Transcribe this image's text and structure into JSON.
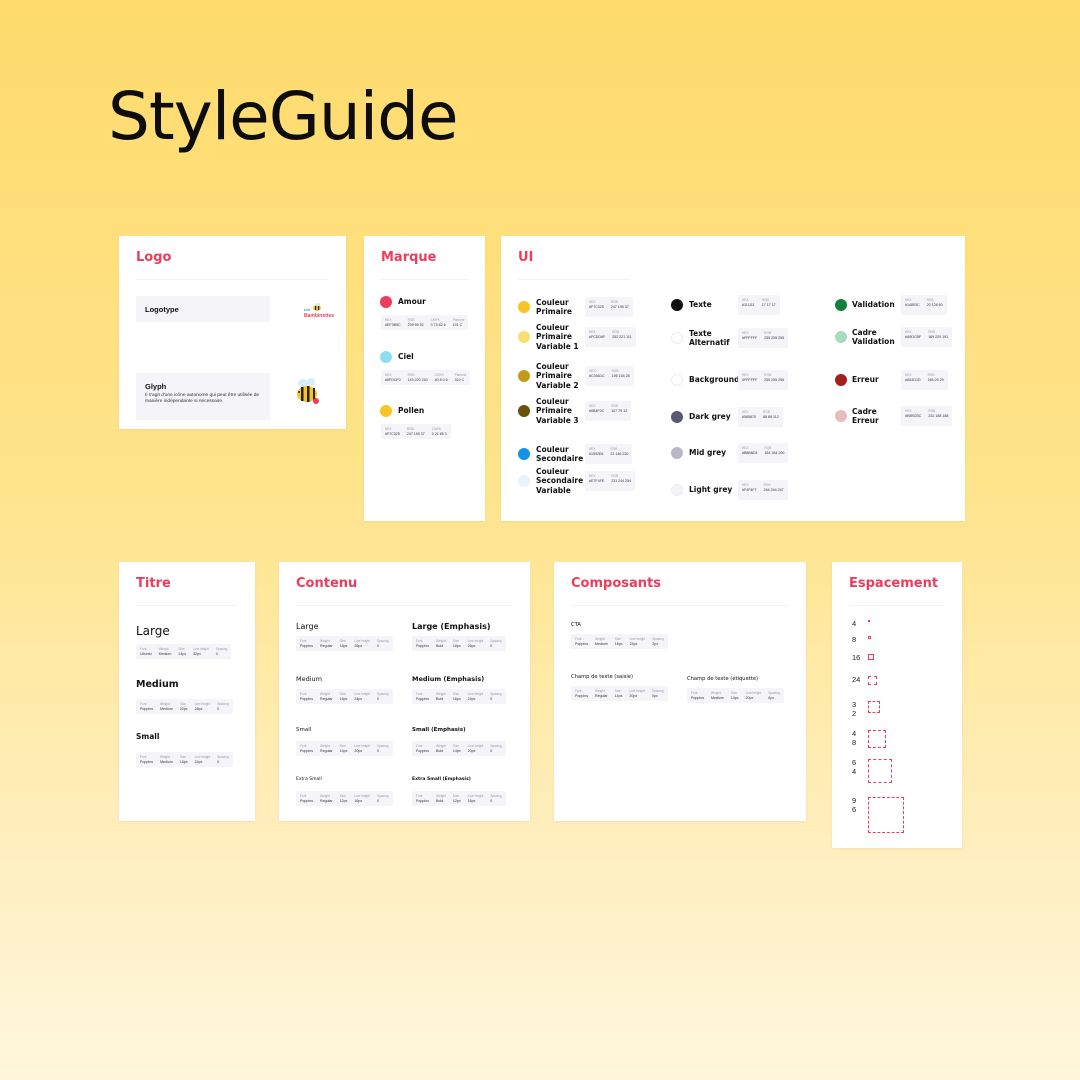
{
  "page": {
    "title": "StyleGuide"
  },
  "colors": {
    "accent": "#ef3b5c"
  },
  "logo_card": {
    "title": "Logo",
    "logotype_label": "Logotype",
    "logotype_icon": "bee-logotype-icon",
    "logotype_text_small": "Les",
    "logotype_text": "Bambinettes",
    "glyph_label": "Glyph",
    "glyph_desc": "Il s'agit d'une icône autonome qui peut être utilisée de manière indépendante si nécessaire.",
    "glyph_icon": "bee-glyph-icon"
  },
  "marque_card": {
    "title": "Marque",
    "items": [
      {
        "name": "Amour",
        "color": "#ef3b5c",
        "specs": [
          [
            "HEX",
            "#EF3B5C"
          ],
          [
            "RGB",
            "239 59 92"
          ],
          [
            "CMYK",
            "0 75 62 6"
          ],
          [
            "Pantone",
            "191 C"
          ]
        ]
      },
      {
        "name": "Ciel",
        "color": "#8fdcf0",
        "specs": [
          [
            "HEX",
            "#8FDCF0"
          ],
          [
            "RGB",
            "143 220 240"
          ],
          [
            "CMYK",
            "40 8 0 6"
          ],
          [
            "Pantone",
            "310 C"
          ]
        ]
      },
      {
        "name": "Pollen",
        "color": "#f7c325",
        "specs": [
          [
            "HEX",
            "#F7C325"
          ],
          [
            "RGB",
            "247 195 37"
          ],
          [
            "CMYK",
            "0 21 85 3"
          ]
        ]
      }
    ]
  },
  "ui_card": {
    "title": "UI",
    "columns": [
      [
        {
          "name": "Couleur Primaire",
          "color": "#f7c325",
          "hex": "#F7C325",
          "rgb": "247 195 37"
        },
        {
          "name": "Couleur Primaire Variable 1",
          "color": "#fcdd6f",
          "hex": "#FCDD6F",
          "rgb": "252 221 111"
        },
        {
          "name": "Couleur Primaire Variable 2",
          "color": "#c39a1c",
          "hex": "#C39A1C",
          "rgb": "195 154 28"
        },
        {
          "name": "Couleur Primaire Variable 3",
          "color": "#6b4f0c",
          "hex": "#6B4F0C",
          "rgb": "107 79 12"
        },
        {
          "name": "Couleur Secondaire",
          "color": "#1592e6",
          "hex": "#1592E6",
          "rgb": "21 146 230"
        },
        {
          "name": "Couleur Secondaire Variable",
          "color": "#e7f4fe",
          "hex": "#E7F4FE",
          "rgb": "231 244 254"
        }
      ],
      [
        {
          "name": "Texte",
          "color": "#111111",
          "hex": "#111111",
          "rgb": "17 17 17"
        },
        {
          "name": "Texte Alternatif",
          "color": "#ffffff",
          "hex": "#FFFFFF",
          "rgb": "255 255 255"
        },
        {
          "name": "Background",
          "color": "#ffffff",
          "hex": "#FFFFFF",
          "rgb": "255 255 255"
        },
        {
          "name": "Dark grey",
          "color": "#585870",
          "hex": "#585870",
          "rgb": "88 88 112"
        },
        {
          "name": "Mid grey",
          "color": "#b8b8c8",
          "hex": "#B8B8C8",
          "rgb": "184 184 200"
        },
        {
          "name": "Light grey",
          "color": "#f4f4f7",
          "hex": "#F4F4F7",
          "rgb": "244 244 247"
        }
      ],
      [
        {
          "name": "Validation",
          "color": "#14803c",
          "hex": "#14803C",
          "rgb": "20 128 60"
        },
        {
          "name": "Cadre Validation",
          "color": "#a9dcbf",
          "hex": "#A9DCBF",
          "rgb": "169 220 191"
        },
        {
          "name": "Erreur",
          "color": "#a51d1d",
          "hex": "#A51D1D",
          "rgb": "165 29 29"
        },
        {
          "name": "Cadre Erreur",
          "color": "#e8bcbc",
          "hex": "#E8BCBC",
          "rgb": "232 188 188"
        }
      ]
    ]
  },
  "titre_card": {
    "title": "Titre",
    "items": [
      {
        "label": "Large",
        "specs": [
          [
            "Font",
            "Ubuntu"
          ],
          [
            "Weight",
            "Medium"
          ],
          [
            "Size",
            "24px"
          ],
          [
            "Line height",
            "32px"
          ],
          [
            "Spacing",
            "0"
          ]
        ]
      },
      {
        "label": "Medium",
        "specs": [
          [
            "Font",
            "Poppins"
          ],
          [
            "Weight",
            "Medium"
          ],
          [
            "Size",
            "20px"
          ],
          [
            "Line height",
            "28px"
          ],
          [
            "Spacing",
            "0"
          ]
        ]
      },
      {
        "label": "Small",
        "specs": [
          [
            "Font",
            "Poppins"
          ],
          [
            "Weight",
            "Medium"
          ],
          [
            "Size",
            "16px"
          ],
          [
            "Line height",
            "24px"
          ],
          [
            "Spacing",
            "0"
          ]
        ]
      }
    ]
  },
  "contenu_card": {
    "title": "Contenu",
    "items": [
      {
        "label": "Large",
        "specs": [
          [
            "Font",
            "Poppins"
          ],
          [
            "Weight",
            "Regular"
          ],
          [
            "Size",
            "18px"
          ],
          [
            "Line height",
            "26px"
          ],
          [
            "Spacing",
            "0"
          ]
        ]
      },
      {
        "label": "Large (Emphasis)",
        "specs": [
          [
            "Font",
            "Poppins"
          ],
          [
            "Weight",
            "Bold"
          ],
          [
            "Size",
            "18px"
          ],
          [
            "Line height",
            "26px"
          ],
          [
            "Spacing",
            "0"
          ]
        ]
      },
      {
        "label": "Medium",
        "specs": [
          [
            "Font",
            "Poppins"
          ],
          [
            "Weight",
            "Regular"
          ],
          [
            "Size",
            "16px"
          ],
          [
            "Line height",
            "24px"
          ],
          [
            "Spacing",
            "0"
          ]
        ]
      },
      {
        "label": "Medium (Emphasis)",
        "specs": [
          [
            "Font",
            "Poppins"
          ],
          [
            "Weight",
            "Bold"
          ],
          [
            "Size",
            "16px"
          ],
          [
            "Line height",
            "24px"
          ],
          [
            "Spacing",
            "0"
          ]
        ]
      },
      {
        "label": "Small",
        "specs": [
          [
            "Font",
            "Poppins"
          ],
          [
            "Weight",
            "Regular"
          ],
          [
            "Size",
            "14px"
          ],
          [
            "Line height",
            "20px"
          ],
          [
            "Spacing",
            "0"
          ]
        ]
      },
      {
        "label": "Small (Emphasis)",
        "specs": [
          [
            "Font",
            "Poppins"
          ],
          [
            "Weight",
            "Bold"
          ],
          [
            "Size",
            "14px"
          ],
          [
            "Line height",
            "20px"
          ],
          [
            "Spacing",
            "0"
          ]
        ]
      },
      {
        "label": "Extra Small",
        "specs": [
          [
            "Font",
            "Poppins"
          ],
          [
            "Weight",
            "Regular"
          ],
          [
            "Size",
            "12px"
          ],
          [
            "Line height",
            "16px"
          ],
          [
            "Spacing",
            "0"
          ]
        ]
      },
      {
        "label": "Extra Small (Emphasis)",
        "specs": [
          [
            "Font",
            "Poppins"
          ],
          [
            "Weight",
            "Bold"
          ],
          [
            "Size",
            "12px"
          ],
          [
            "Line height",
            "16px"
          ],
          [
            "Spacing",
            "0"
          ]
        ]
      }
    ]
  },
  "composants_card": {
    "title": "Composants",
    "items": [
      {
        "label": "CTA",
        "specs": [
          [
            "Font",
            "Poppins"
          ],
          [
            "Weight",
            "Medium"
          ],
          [
            "Size",
            "16px"
          ],
          [
            "Line height",
            "24px"
          ],
          [
            "Spacing",
            "2px"
          ]
        ]
      },
      {
        "label": "Champ de texte (saisie)",
        "specs": [
          [
            "Font",
            "Poppins"
          ],
          [
            "Weight",
            "Regular"
          ],
          [
            "Size",
            "14px"
          ],
          [
            "Line height",
            "20px"
          ],
          [
            "Spacing",
            "0px"
          ]
        ]
      },
      {
        "label": "Champ de texte (étiquette)",
        "specs": [
          [
            "Font",
            "Poppins"
          ],
          [
            "Weight",
            "Medium"
          ],
          [
            "Size",
            "14px"
          ],
          [
            "Line height",
            "20px"
          ],
          [
            "Spacing",
            "0px"
          ]
        ]
      }
    ]
  },
  "espacement_card": {
    "title": "Espacement",
    "sizes": [
      "4",
      "8",
      "16",
      "24",
      "32",
      "48",
      "64",
      "96"
    ]
  }
}
